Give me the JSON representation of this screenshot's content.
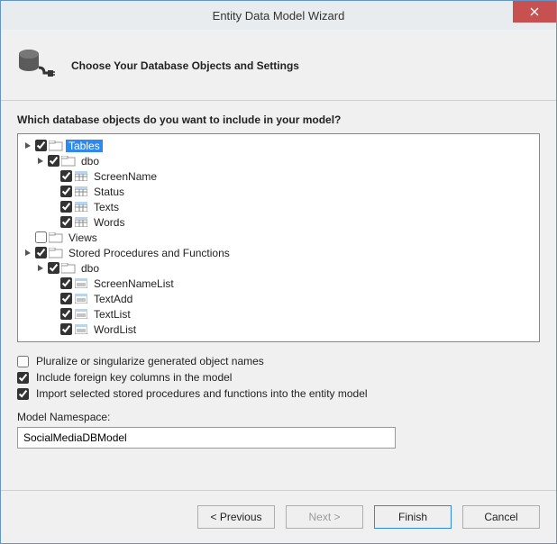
{
  "window": {
    "title": "Entity Data Model Wizard"
  },
  "header": {
    "subtitle": "Choose Your Database Objects and Settings"
  },
  "question": "Which database objects do you want to include in your model?",
  "tree": {
    "tables": {
      "label": "Tables",
      "checked": true,
      "expanded": true,
      "selected": true
    },
    "tables_dbo": {
      "label": "dbo",
      "checked": true,
      "expanded": true
    },
    "t_screenname": {
      "label": "ScreenName",
      "checked": true
    },
    "t_status": {
      "label": "Status",
      "checked": true
    },
    "t_texts": {
      "label": "Texts",
      "checked": true
    },
    "t_words": {
      "label": "Words",
      "checked": true
    },
    "views": {
      "label": "Views",
      "checked": false,
      "expanded": false
    },
    "sprocs": {
      "label": "Stored Procedures and Functions",
      "checked": true,
      "expanded": true
    },
    "sprocs_dbo": {
      "label": "dbo",
      "checked": true,
      "expanded": true
    },
    "sp_screennamelist": {
      "label": "ScreenNameList",
      "checked": true
    },
    "sp_textadd": {
      "label": "TextAdd",
      "checked": true
    },
    "sp_textlist": {
      "label": "TextList",
      "checked": true
    },
    "sp_wordlist": {
      "label": "WordList",
      "checked": true
    }
  },
  "options": {
    "pluralize": {
      "label": "Pluralize or singularize generated object names",
      "checked": false
    },
    "fk": {
      "label": "Include foreign key columns in the model",
      "checked": true
    },
    "import_sp": {
      "label": "Import selected stored procedures and functions into the entity model",
      "checked": true
    }
  },
  "namespace": {
    "label": "Model Namespace:",
    "value": "SocialMediaDBModel"
  },
  "buttons": {
    "previous": "< Previous",
    "next": "Next >",
    "finish": "Finish",
    "cancel": "Cancel"
  }
}
